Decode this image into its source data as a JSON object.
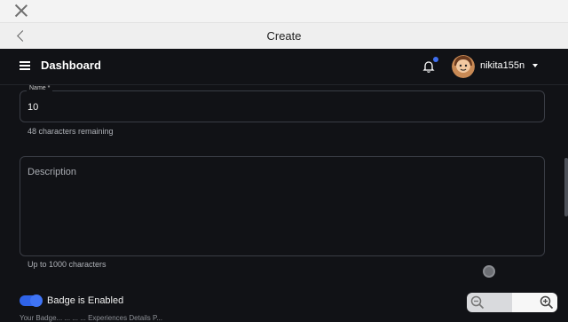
{
  "browser": {
    "page_title": "Create"
  },
  "app": {
    "title": "Dashboard",
    "username": "nikita155n"
  },
  "form": {
    "name": {
      "label": "Name *",
      "value": "10",
      "helper": "48 characters remaining"
    },
    "description": {
      "placeholder": "Description",
      "helper": "Up to 1000 characters"
    },
    "badge_toggle": {
      "label": "Badge is Enabled",
      "enabled": true
    },
    "cutoff_text": "Your Badge... ... ... ... Experiences Details P..."
  },
  "colors": {
    "accent": "#2f63e8",
    "notification_dot": "#3f6ff0",
    "background": "#111216"
  },
  "icons": [
    "close-icon",
    "back-chevron-icon",
    "menu-icon",
    "bell-icon",
    "chevron-down-icon",
    "zoom-out-icon",
    "zoom-in-icon"
  ]
}
